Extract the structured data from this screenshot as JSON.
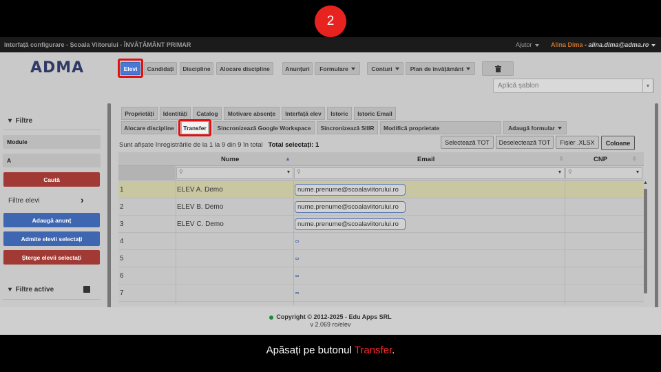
{
  "step_number": "2",
  "topbar": {
    "title": "Interfață configurare - Școala Viitorului - ÎNVĂȚĂMÂNT PRIMAR",
    "help": "Ajutor",
    "user_name": "Alina Dima",
    "user_sep": " - ",
    "user_email": "alina.dima@adma.ro"
  },
  "logo": "ADMA",
  "toolbar": {
    "elevi": "Elevi",
    "candidati": "Candidați",
    "discipline": "Discipline",
    "alocare_discipline": "Alocare discipline",
    "anunturi": "Anunțuri",
    "formulare": "Formulare",
    "conturi": "Conturi",
    "plan": "Plan de învățământ",
    "template_placeholder": "Aplică șablon"
  },
  "sidebar": {
    "filters_title": "Filtre",
    "module_label": "Module",
    "a_label": "A",
    "search_button": "Caută",
    "student_filters": "Filtre elevi",
    "add_announcement": "Adaugă anunț",
    "admit_selected": "Admite elevii selectați",
    "delete_selected": "Șterge elevii selectați",
    "active_filters": "Filtre active"
  },
  "tabs_row1": [
    "Proprietăți",
    "Identități",
    "Catalog",
    "Motivare absențe",
    "Interfață elev",
    "Istoric",
    "Istoric Email"
  ],
  "tabs_row2": {
    "alocare": "Alocare discipline",
    "transfer": "Transfer",
    "google": "Sincronizează Google Workspace",
    "siiir": "Sincronizează SIIIR",
    "modifica": "Modifică proprietate",
    "adauga_formular": "Adaugă formular"
  },
  "info": {
    "showing": "Sunt afișate înregistrările de la 1 la 9 din 9 în total",
    "total_selected": "Total selectați: 1"
  },
  "actions": {
    "select_all": "Selectează TOT",
    "deselect_all": "Deselectează TOT",
    "xlsx": "Fișier .XLSX",
    "columns": "Coloane"
  },
  "grid": {
    "columns": [
      "Nume",
      "Email",
      "CNP"
    ],
    "rows": [
      {
        "num": "1",
        "name": "ELEV A. Demo",
        "email": "nume.prenume@scoalaviitorului.ro"
      },
      {
        "num": "2",
        "name": "ELEV B. Demo",
        "email": "nume.prenume@scoalaviitorului.ro"
      },
      {
        "num": "3",
        "name": "ELEV C. Demo",
        "email": "nume.prenume@scoalaviitorului.ro"
      },
      {
        "num": "4",
        "name": "",
        "email": ""
      },
      {
        "num": "5",
        "name": "",
        "email": ""
      },
      {
        "num": "6",
        "name": "",
        "email": ""
      },
      {
        "num": "7",
        "name": "",
        "email": ""
      }
    ]
  },
  "footer": {
    "copyright": "Copyright © 2012-2025 - Edu Apps SRL",
    "version": "v 2.069 ro/elev"
  },
  "caption": {
    "prefix": "Apăsați pe butonul ",
    "highlight": "Transfer",
    "suffix": "."
  }
}
